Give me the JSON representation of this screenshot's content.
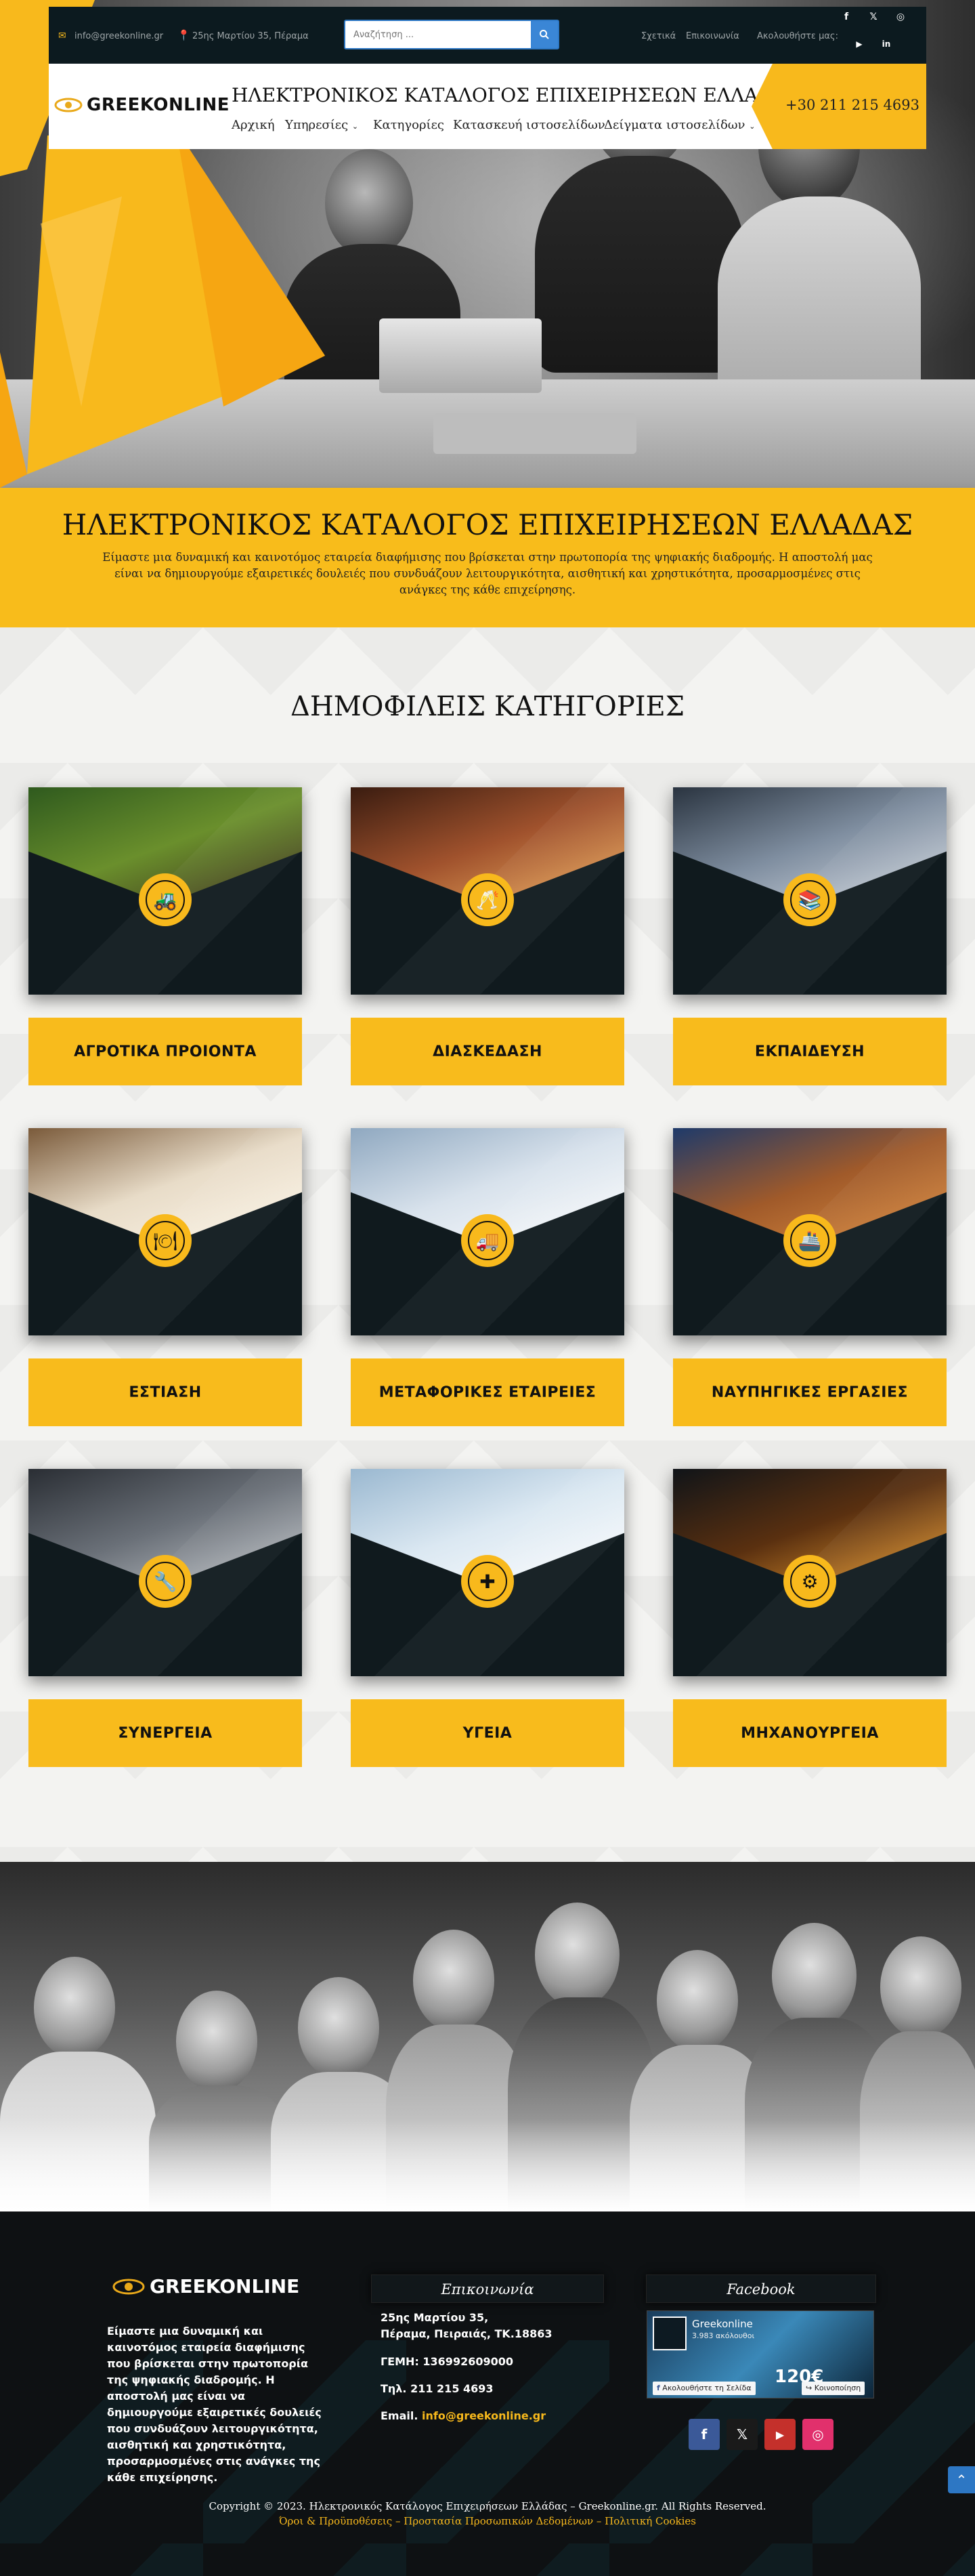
{
  "topbar": {
    "email": "info@greekonline.gr",
    "address": "25ης Μαρτίου 35, Πέραμα",
    "search_placeholder": "Αναζήτηση ...",
    "links": [
      "Σχετικά",
      "Επικοινωνία",
      "Ακολουθήστε μας:"
    ],
    "social_icons": [
      "facebook-icon",
      "x-icon",
      "instagram-icon",
      "youtube-icon",
      "linkedin-icon"
    ]
  },
  "header": {
    "logo_text": "GREEKONLINE",
    "site_title": "ΗΛΕΚΤΡΟΝΙΚΟΣ ΚΑΤΑΛΟΓΟΣ ΕΠΙΧΕΙΡΗΣΕΩΝ ΕΛΛΑΔΟΣ",
    "phone": "+30 211 215 4693",
    "nav": [
      {
        "label": "Αρχική",
        "dropdown": false
      },
      {
        "label": "Υπηρεσίες",
        "dropdown": true
      },
      {
        "label": "Κατηγορίες",
        "dropdown": false
      },
      {
        "label": "Κατασκευή ιστοσελίδων",
        "dropdown": false
      },
      {
        "label": "Δείγματα ιστοσελίδων",
        "dropdown": true
      }
    ]
  },
  "intro": {
    "title": "ΗΛΕΚΤΡΟΝΙΚΟΣ ΚΑΤΑΛΟΓΟΣ ΕΠΙΧΕΙΡΗΣΕΩΝ ΕΛΛΑΔΑΣ",
    "text": "Είμαστε μια δυναμική και καινοτόμος εταιρεία διαφήμισης που βρίσκεται στην πρωτοπορία της ψηφιακής διαδρομής. Η αποστολή μας είναι να δημιουργούμε εξαιρετικές δουλειές που συνδυάζουν λειτουργικότητα, αισθητική και χρηστικότητα, προσαρμοσμένες στις ανάγκες της κάθε επιχείρησης."
  },
  "categories": {
    "heading": "ΔΗΜΟΦΙΛΕΙΣ ΚΑΤΗΓΟΡΙΕΣ",
    "items": [
      {
        "label": "ΑΓΡΟΤΙΚΑ ΠΡΟΙΟΝΤΑ",
        "icon": "tractor-icon",
        "glyph": "🚜",
        "photo": [
          "#2f5a1e",
          "#6a8f2c",
          "#3b2a1c"
        ]
      },
      {
        "label": "ΔΙΑΣΚΕΔΑΣΗ",
        "icon": "cheers-icon",
        "glyph": "🥂",
        "photo": [
          "#3a1c10",
          "#a0522d",
          "#f0b060"
        ]
      },
      {
        "label": "ΕΚΠΑΙΔΕΥΣΗ",
        "icon": "books-icon",
        "glyph": "📚",
        "photo": [
          "#2a3440",
          "#7f8ea0",
          "#d8dde4"
        ]
      },
      {
        "label": "ΕΣΤΙΑΣΗ",
        "icon": "restaurant-icon",
        "glyph": "🍽",
        "photo": [
          "#7a5a3a",
          "#e8dcc8",
          "#fff8ec"
        ]
      },
      {
        "label": "ΜΕΤΑΦΟΡΙΚΕΣ ΕΤΑΙΡΕΙΕΣ",
        "icon": "truck-icon",
        "glyph": "🚚",
        "photo": [
          "#8fa8c0",
          "#d8e2ec",
          "#ffffff"
        ]
      },
      {
        "label": "ΝΑΥΠΗΓΙΚΕΣ ΕΡΓΑΣΙΕΣ",
        "icon": "ship-icon",
        "glyph": "🚢",
        "photo": [
          "#1e3a6a",
          "#a05a2a",
          "#e09040"
        ]
      },
      {
        "label": "ΣΥΝΕΡΓΕΙΑ",
        "icon": "tools-icon",
        "glyph": "🔧",
        "photo": [
          "#2a2e34",
          "#6a7078",
          "#c8ccd0"
        ]
      },
      {
        "label": "ΥΓΕΙΑ",
        "icon": "health-icon",
        "glyph": "✚",
        "photo": [
          "#9ab8d0",
          "#dbe8f2",
          "#ffffff"
        ]
      },
      {
        "label": "ΜΗΧΑΝΟΥΡΓΕΙΑ",
        "icon": "gears-icon",
        "glyph": "⚙",
        "photo": [
          "#101418",
          "#5a3010",
          "#f0a030"
        ]
      }
    ]
  },
  "footer": {
    "logo_text": "GREEKONLINE",
    "about": "Είμαστε μια δυναμική και καινοτόμος εταιρεία διαφήμισης που βρίσκεται στην πρωτοπορία της ψηφιακής διαδρομής. Η αποστολή μας είναι να δημιουργούμε εξαιρετικές δουλειές που συνδυάζουν λειτουργικότητα, αισθητική και χρηστικότητα, προσαρμοσμένες στις ανάγκες της κάθε επιχείρησης.",
    "contact_heading": "Επικοινωνία",
    "address_line1": "25ης Μαρτίου 35,",
    "address_line2": "Πέραμα, Πειραιάς, ΤΚ.18863",
    "gemi": "ΓΕΜΗ: 136992609000",
    "phone": "Τηλ. 211 215 4693",
    "email_label": "Email.",
    "email": "info@greekonline.gr",
    "facebook_heading": "Facebook",
    "fb_page_name": "Greekonline",
    "fb_followers": "3.983 ακόλουθοι",
    "fb_follow": "Ακολουθήστε τη Σελίδα",
    "fb_share": "Κοινοποίηση",
    "fb_price": "120€",
    "copyright": "Copyright © 2023. Ηλεκτρονικός Κατάλογος Επιχειρήσεων Ελλάδας – Greekonline.gr. All Rights Reserved.",
    "legal": "Όροι & Προϋποθέσεις – Προστασία Προσωπικών Δεδομένων – Πολιτική Cookies",
    "social": [
      {
        "icon": "facebook-icon",
        "glyph": "f",
        "color": "#3b5998"
      },
      {
        "icon": "x-icon",
        "glyph": "𝕏",
        "color": "#1a1a1a"
      },
      {
        "icon": "youtube-icon",
        "glyph": "▶",
        "color": "#c4302b"
      },
      {
        "icon": "instagram-icon",
        "glyph": "◎",
        "color": "#e1306c"
      }
    ]
  },
  "colors": {
    "accent": "#f8b91c",
    "dark": "#0c1a1f",
    "link": "#2d77c4"
  }
}
